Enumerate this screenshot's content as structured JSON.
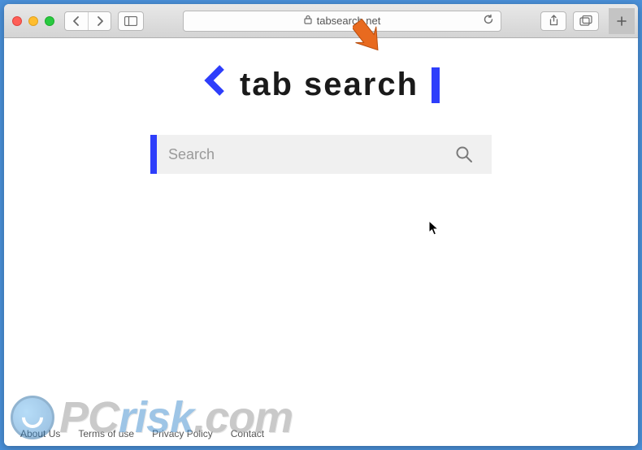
{
  "browser": {
    "url_display": "tabsearch.net",
    "lock": true
  },
  "page": {
    "logo_text": "tab search",
    "search": {
      "placeholder": "Search",
      "value": ""
    },
    "footer_links": [
      "About Us",
      "Terms of use",
      "Privacy Policy",
      "Contact"
    ]
  },
  "watermark": {
    "text_prefix": "PC",
    "text_mid": "risk",
    "text_suffix": ".com"
  }
}
